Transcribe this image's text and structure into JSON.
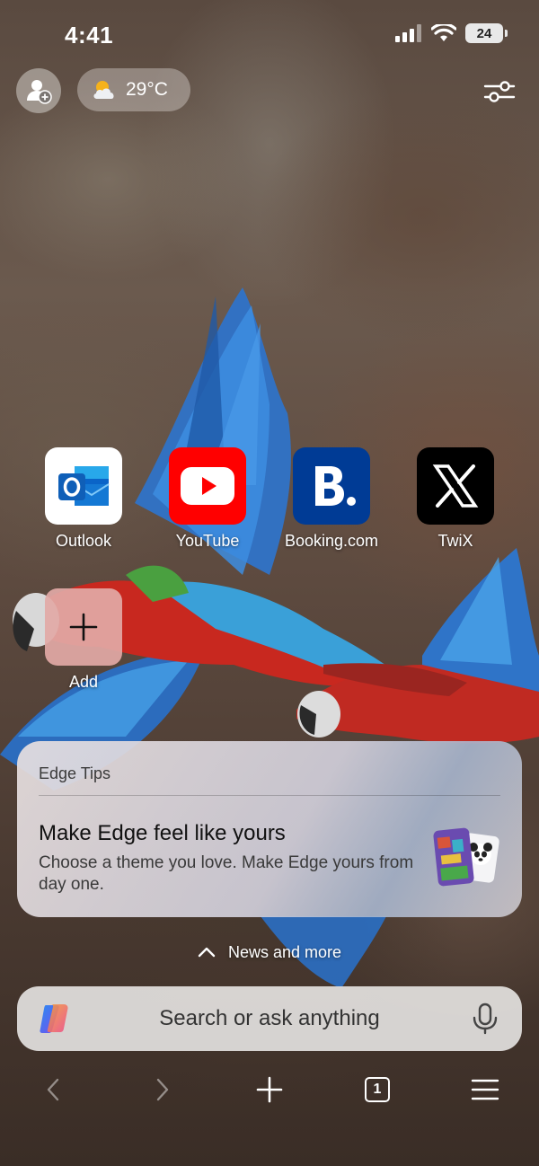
{
  "status_bar": {
    "time": "4:41",
    "battery": "24"
  },
  "top_bar": {
    "weather_temp": "29°C",
    "weather_icon": "partly-cloudy-icon",
    "profile_icon": "profile-add-icon",
    "settings_icon": "sliders-icon"
  },
  "shortcuts": [
    {
      "label": "Outlook",
      "icon": "outlook-icon",
      "color": "#ffffff"
    },
    {
      "label": "YouTube",
      "icon": "youtube-icon",
      "color": "#ff0000"
    },
    {
      "label": "Booking.com",
      "icon": "booking-icon",
      "color": "#003b95"
    },
    {
      "label": "TwiX",
      "icon": "x-icon",
      "color": "#000000"
    },
    {
      "label": "Add",
      "icon": "plus-icon",
      "color": "#e2a9a6"
    }
  ],
  "tips": {
    "header": "Edge Tips",
    "title": "Make Edge feel like yours",
    "body": "Choose a theme you love. Make Edge yours from day one."
  },
  "news": {
    "label": "News and more"
  },
  "search": {
    "placeholder": "Search or ask anything"
  },
  "bottom_nav": {
    "tab_count": "1"
  }
}
